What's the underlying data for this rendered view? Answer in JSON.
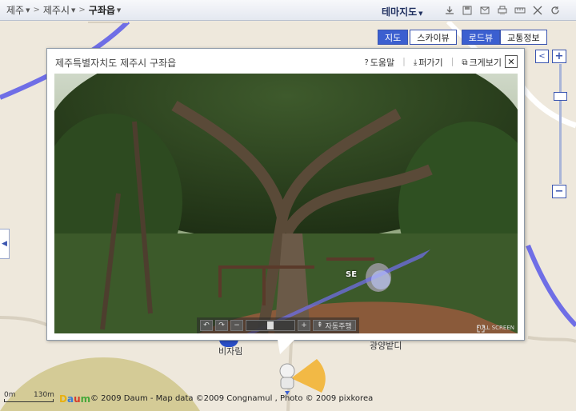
{
  "breadcrumb": {
    "items": [
      "제주",
      "제주시",
      "구좌읍"
    ]
  },
  "topbar": {
    "theme_label": "테마지도",
    "tools": [
      "download-icon",
      "save-icon",
      "mail-icon",
      "print-icon",
      "ruler-icon",
      "expand-icon",
      "refresh-icon"
    ]
  },
  "map_types": {
    "map": "지도",
    "skyview": "스카이뷰",
    "roadview": "로드뷰",
    "traffic": "교통정보"
  },
  "zoom": {
    "level_fraction": 0.25
  },
  "popup": {
    "title": "제주특별자치도 제주시 구좌읍",
    "help": "도움말",
    "open": "퍼가기",
    "enlarge": "크게보기",
    "compass": "SE",
    "auto_play": "자동주행",
    "fullscreen": "FULL SCREEN"
  },
  "map_labels": {
    "place1": "비자림",
    "place2": "광양밭디"
  },
  "footer": {
    "scale_left": "0m",
    "scale_right": "130m",
    "logo": [
      "D",
      "a",
      "u",
      "m"
    ],
    "copyright": "© 2009 Daum - Map data ©2009 Congnamul , Photo © 2009 pixkorea"
  },
  "colors": {
    "accent": "#3b5fd0",
    "road": "#5a5ae8"
  }
}
